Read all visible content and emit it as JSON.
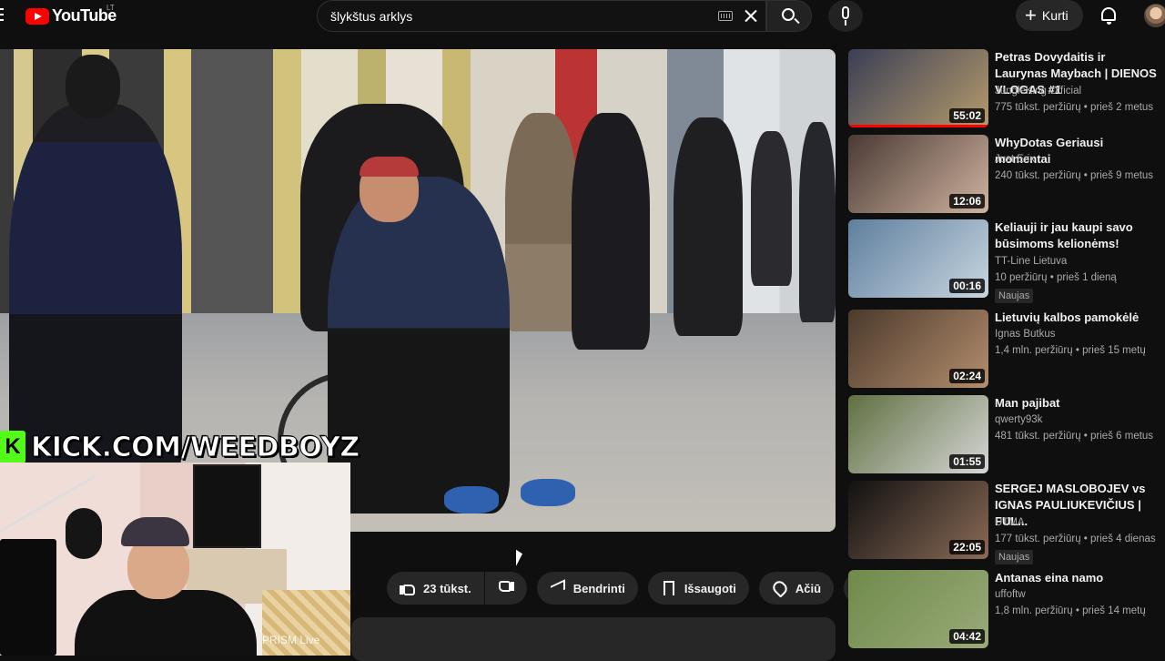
{
  "header": {
    "logo_text": "YouTube",
    "logo_region": "LT",
    "search_value": "šlykštus arklys",
    "create_label": "Kurti"
  },
  "overlay": {
    "kick_text": "KICK.COM/WEEDBOYZ",
    "prism_label": "PRISM Live"
  },
  "actions": {
    "like_count": "23 tūkst.",
    "share_label": "Bendrinti",
    "save_label": "Išsaugoti",
    "thanks_label": "Ačiū",
    "more_label": "•••"
  },
  "recommendations": [
    {
      "title": "Petras Dovydaitis ir Laurynas Maybach | DIENOS VLOGAS #1",
      "channel": "JungleKing Official",
      "meta": "775 tūkst. peržiūrų • prieš 2 metus",
      "duration": "55:02",
      "badge": "",
      "progress": 1.0,
      "thumb_colors": [
        "#3a3f55",
        "#b59a6c"
      ]
    },
    {
      "title": "WhyDotas Geriausi momentai",
      "channel": "Just Erix",
      "meta": "240 tūkst. peržiūrų • prieš 9 metus",
      "duration": "12:06",
      "badge": "",
      "progress": 0.0,
      "thumb_colors": [
        "#4a3a34",
        "#cfb3a0"
      ]
    },
    {
      "title": "Keliauji ir jau kaupi savo būsimoms kelionėms!",
      "channel": "TT-Line Lietuva",
      "meta": "10 peržiūrų • prieš 1 dieną",
      "duration": "00:16",
      "badge": "Naujas",
      "progress": 0.0,
      "thumb_colors": [
        "#5f7f9e",
        "#c8d6e0"
      ]
    },
    {
      "title": "Lietuvių kalbos pamokėlė",
      "channel": "Ignas Butkus",
      "meta": "1,4 mln. peržiūrų • prieš 15 metų",
      "duration": "02:24",
      "badge": "",
      "progress": 0.0,
      "thumb_colors": [
        "#4b3a2c",
        "#b48e6e"
      ]
    },
    {
      "title": "Man pajibat",
      "channel": "qwerty93k",
      "meta": "481 tūkst. peržiūrų • prieš 6 metus",
      "duration": "01:55",
      "badge": "",
      "progress": 0.0,
      "thumb_colors": [
        "#5f7040",
        "#d6d6d6"
      ]
    },
    {
      "title": "SERGEJ MASLOBOJEV vs IGNAS PAULIUKEVIČIUS | FUL...",
      "channel": "UTMA",
      "meta": "177 tūkst. peržiūrų • prieš 4 dienas",
      "duration": "22:05",
      "badge": "Naujas",
      "progress": 0.0,
      "thumb_colors": [
        "#111111",
        "#8a6a55"
      ]
    },
    {
      "title": "Antanas eina namo",
      "channel": "uffoftw",
      "meta": "1,8 mln. peržiūrų • prieš 14 metų",
      "duration": "04:42",
      "badge": "",
      "progress": 0.0,
      "thumb_colors": [
        "#6f8a4a",
        "#9aaa7a"
      ]
    }
  ]
}
